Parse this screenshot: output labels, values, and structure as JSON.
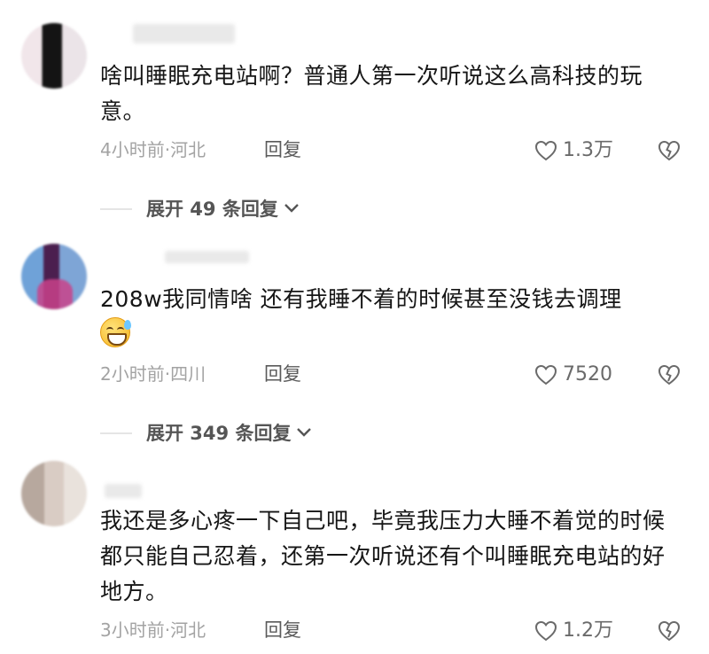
{
  "comments": [
    {
      "text": "啥叫睡眠充电站啊？普通人第一次听说这么高科技的玩意。",
      "time_location": "4小时前·河北",
      "reply_label": "回复",
      "likes": "1.3万",
      "expand_label": "展开 49 条回复"
    },
    {
      "text": "208w我同情啥 还有我睡不着的时候甚至没钱去调理",
      "emoji": "grinning-sweat-emoji",
      "time_location": "2小时前·四川",
      "reply_label": "回复",
      "likes": "7520",
      "expand_label": "展开 349 条回复"
    },
    {
      "text": "我还是多心疼一下自己吧，毕竟我压力大睡不着觉的时候都只能自己忍着，还第一次听说还有个叫睡眠充电站的好地方。",
      "time_location": "3小时前·河北",
      "reply_label": "回复",
      "likes": "1.2万"
    }
  ],
  "icons": {
    "like": "heart-outline-icon",
    "dislike": "broken-heart-icon",
    "expand": "chevron-down-icon"
  },
  "colors": {
    "text": "#161616",
    "meta": "#a3a3a3",
    "background": "#ffffff"
  }
}
